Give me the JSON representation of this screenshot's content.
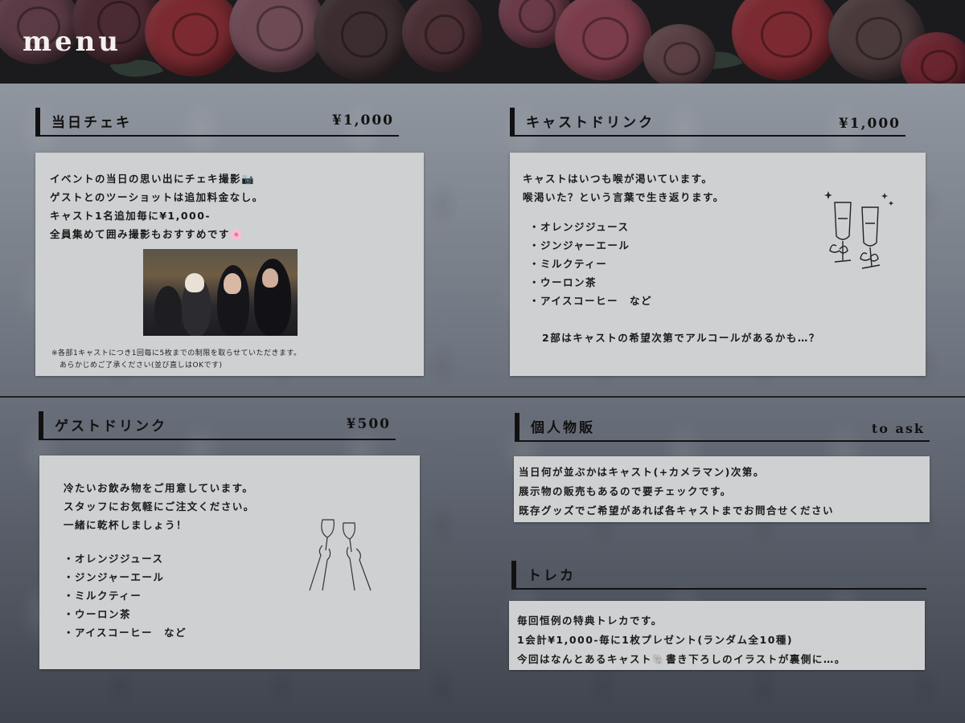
{
  "page": {
    "title": "menu"
  },
  "sections": {
    "cheki": {
      "title": "当日チェキ",
      "price": "¥1,000",
      "lines": [
        "イベントの当日の思い出にチェキ撮影📷",
        "ゲストとのツーショットは追加料金なし。",
        "キャスト1名追加毎に¥1,000-",
        "全員集めて囲み撮影もおすすめです🌸"
      ],
      "notes": [
        "※各部1キャストにつき1回毎に5枚までの制限を取らせていただきます。",
        "あらかじめご了承ください(並び直しはOKです)"
      ]
    },
    "cast_drink": {
      "title": "キャストドリンク",
      "price": "¥1,000",
      "lines": [
        "キャストはいつも喉が渇いています。",
        "喉渇いた？という言葉で生き返ります。"
      ],
      "items": [
        "オレンジジュース",
        "ジンジャーエール",
        "ミルクティー",
        "ウーロン茶",
        "アイスコーヒー　など"
      ],
      "footer": "2部はキャストの希望次第でアルコールがあるかも…？"
    },
    "guest_drink": {
      "title": "ゲストドリンク",
      "price": "¥500",
      "lines": [
        "冷たいお飲み物をご用意しています。",
        "スタッフにお気軽にご注文ください。",
        "一緒に乾杯しましょう！"
      ],
      "items": [
        "オレンジジュース",
        "ジンジャーエール",
        "ミルクティー",
        "ウーロン茶",
        "アイスコーヒー　など"
      ]
    },
    "merch": {
      "title": "個人物販",
      "price": "to ask",
      "lines": [
        "当日何が並ぶかはキャスト(+カメラマン)次第。",
        "展示物の販売もあるので要チェックです。",
        "既存グッズでご希望があれば各キャストまでお問合せください"
      ]
    },
    "toreka": {
      "title": "トレカ",
      "lines": [
        "毎回恒例の特典トレカです。",
        "1会計¥1,000-毎に1枚プレゼント(ランダム全10種)",
        "今回はなんとあるキャスト🐘書き下ろしのイラストが裏側に…。"
      ]
    }
  },
  "colors": {
    "banner": "#1b1a1d",
    "card": "#cfd0d1",
    "heading_rule": "#111111"
  },
  "icons": [
    "camera-icon",
    "flower-icon",
    "champagne-glasses-icon",
    "wine-toast-icon",
    "sparkle-icon"
  ]
}
